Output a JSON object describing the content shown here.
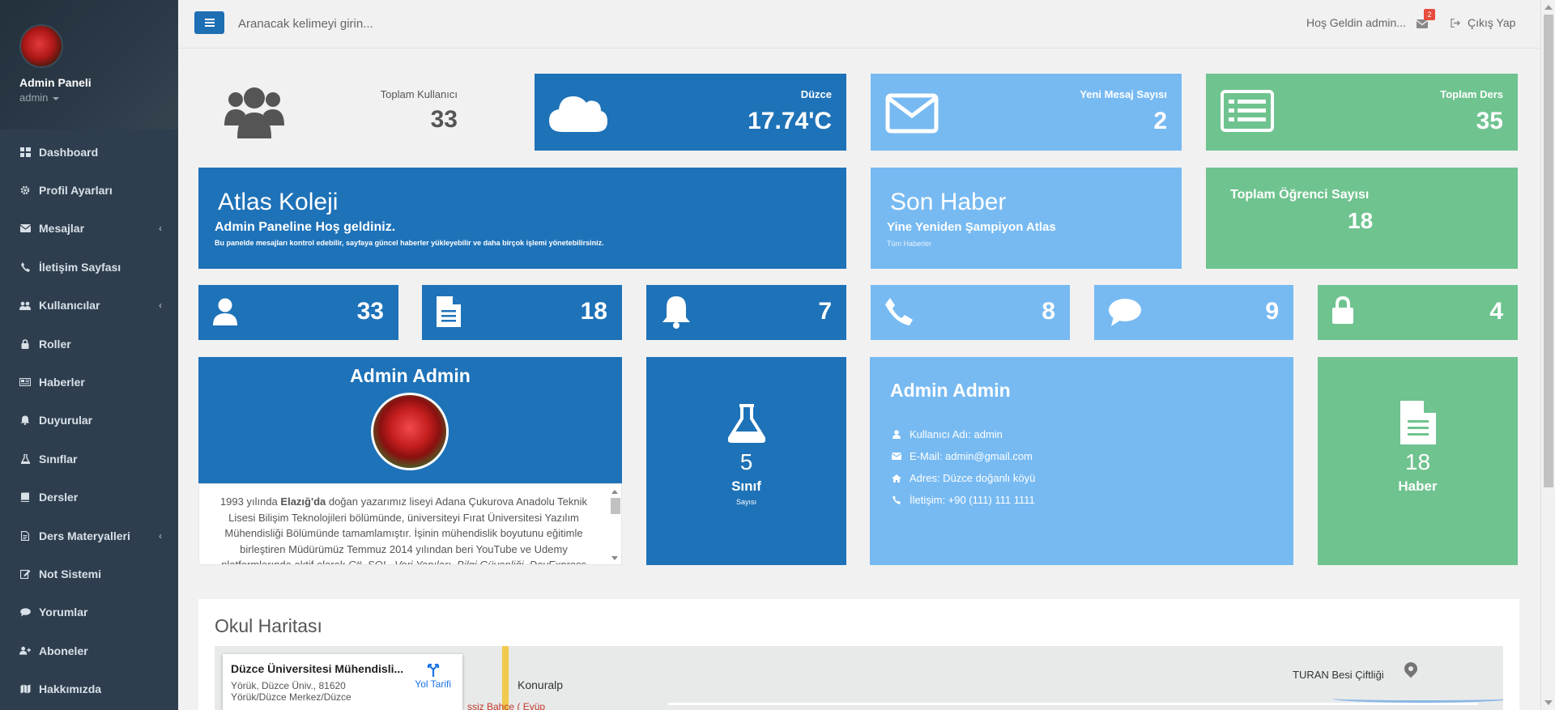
{
  "sidebar": {
    "profile_name": "Admin Paneli",
    "profile_role": "admin",
    "items": [
      {
        "label": "Dashboard",
        "icon": "dashboard-icon"
      },
      {
        "label": "Profil Ayarları",
        "icon": "gear-icon"
      },
      {
        "label": "Mesajlar",
        "icon": "envelope-icon",
        "chevron": true
      },
      {
        "label": "İletişim Sayfası",
        "icon": "phone-icon"
      },
      {
        "label": "Kullanıcılar",
        "icon": "users-icon",
        "chevron": true
      },
      {
        "label": "Roller",
        "icon": "lock-icon"
      },
      {
        "label": "Haberler",
        "icon": "newspaper-icon"
      },
      {
        "label": "Duyurular",
        "icon": "bell-icon"
      },
      {
        "label": "Sınıflar",
        "icon": "flask-icon"
      },
      {
        "label": "Dersler",
        "icon": "book-icon"
      },
      {
        "label": "Ders Materyalleri",
        "icon": "file-icon",
        "chevron": true
      },
      {
        "label": "Not Sistemi",
        "icon": "edit-icon"
      },
      {
        "label": "Yorumlar",
        "icon": "comment-icon"
      },
      {
        "label": "Aboneler",
        "icon": "user-plus-icon"
      },
      {
        "label": "Hakkımızda",
        "icon": "map-icon"
      }
    ]
  },
  "topbar": {
    "search_placeholder": "Aranacak kelimeyi girin...",
    "welcome": "Hoş Geldin admin...",
    "mail_count": "2",
    "logout_label": "Çıkış Yap"
  },
  "stats_row1": {
    "users": {
      "label": "Toplam Kullanıcı",
      "value": "33"
    },
    "weather": {
      "label": "Düzce",
      "value": "17.74'C"
    },
    "messages": {
      "label": "Yeni Mesaj Sayısı",
      "value": "2"
    },
    "courses": {
      "label": "Toplam Ders",
      "value": "35"
    }
  },
  "banner": {
    "title": "Atlas Koleji",
    "subtitle": "Admin Paneline Hoş geldiniz.",
    "description": "Bu panelde mesajları kontrol edebilir, sayfaya güncel haberler yükleyebilir ve daha birçok işlemi yönetebilirsiniz."
  },
  "news": {
    "title": "Son Haber",
    "headline": "Yine Yeniden Şampiyon Atlas",
    "link": "Tüm Haberler"
  },
  "students": {
    "label": "Toplam Öğrenci Sayısı",
    "value": "18"
  },
  "mini_stats": [
    {
      "value": "33",
      "icon": "user-icon"
    },
    {
      "value": "18",
      "icon": "file-text-icon"
    },
    {
      "value": "7",
      "icon": "bell-icon"
    },
    {
      "value": "8",
      "icon": "phone-icon"
    },
    {
      "value": "9",
      "icon": "comment-icon"
    },
    {
      "value": "4",
      "icon": "lock-icon"
    }
  ],
  "profile": {
    "name": "Admin Admin",
    "bio_pre": "1993 yılında ",
    "bio_bold": "Elazığ'da",
    "bio_post": " doğan yazarımız liseyi Adana Çukurova Anadolu Teknik Lisesi Bilişim Teknolojileri bölümünde, üniversiteyi Fırat Üniversitesi Yazılım Mühendisliği Bölümünde tamamlamıştır. İşinin mühendislik boyutunu eğitimle birleştiren Müdürümüz Temmuz 2014 yılından beri YouTube ve Udemy platformlarında aktif olarak ",
    "bio_italic": "C#, SQL, Veri Yapıları, Bilgi Güvenliği, DevExpress"
  },
  "classes": {
    "value": "5",
    "label": "Sınıf",
    "sub": "Sayısı"
  },
  "info": {
    "name": "Admin Admin",
    "username": "Kullanıcı Adı: admin",
    "email": "E-Mail: admin@gmail.com",
    "address": "Adres: Düzce doğanlı köyü",
    "phone": "İletişim: +90 (111) 111 1111"
  },
  "news_count": {
    "value": "18",
    "label": "Haber"
  },
  "map": {
    "title": "Okul Haritası",
    "place_name": "Düzce Üniversitesi Mühendisli...",
    "place_addr1": "Yörük, Düzce Üniv., 81620",
    "place_addr2": "Yörük/Düzce Merkez/Düzce",
    "directions": "Yol Tarifi",
    "label_town": "Konuralp",
    "label_farm": "TURAN Besi Çiftliği",
    "label_partial": "ssiz Bahçe ( Eyüp"
  },
  "colors": {
    "sidebar": "#2e3e4e",
    "dark_blue": "#1e72b8",
    "light_blue": "#77baf2",
    "green": "#6fc38f"
  }
}
